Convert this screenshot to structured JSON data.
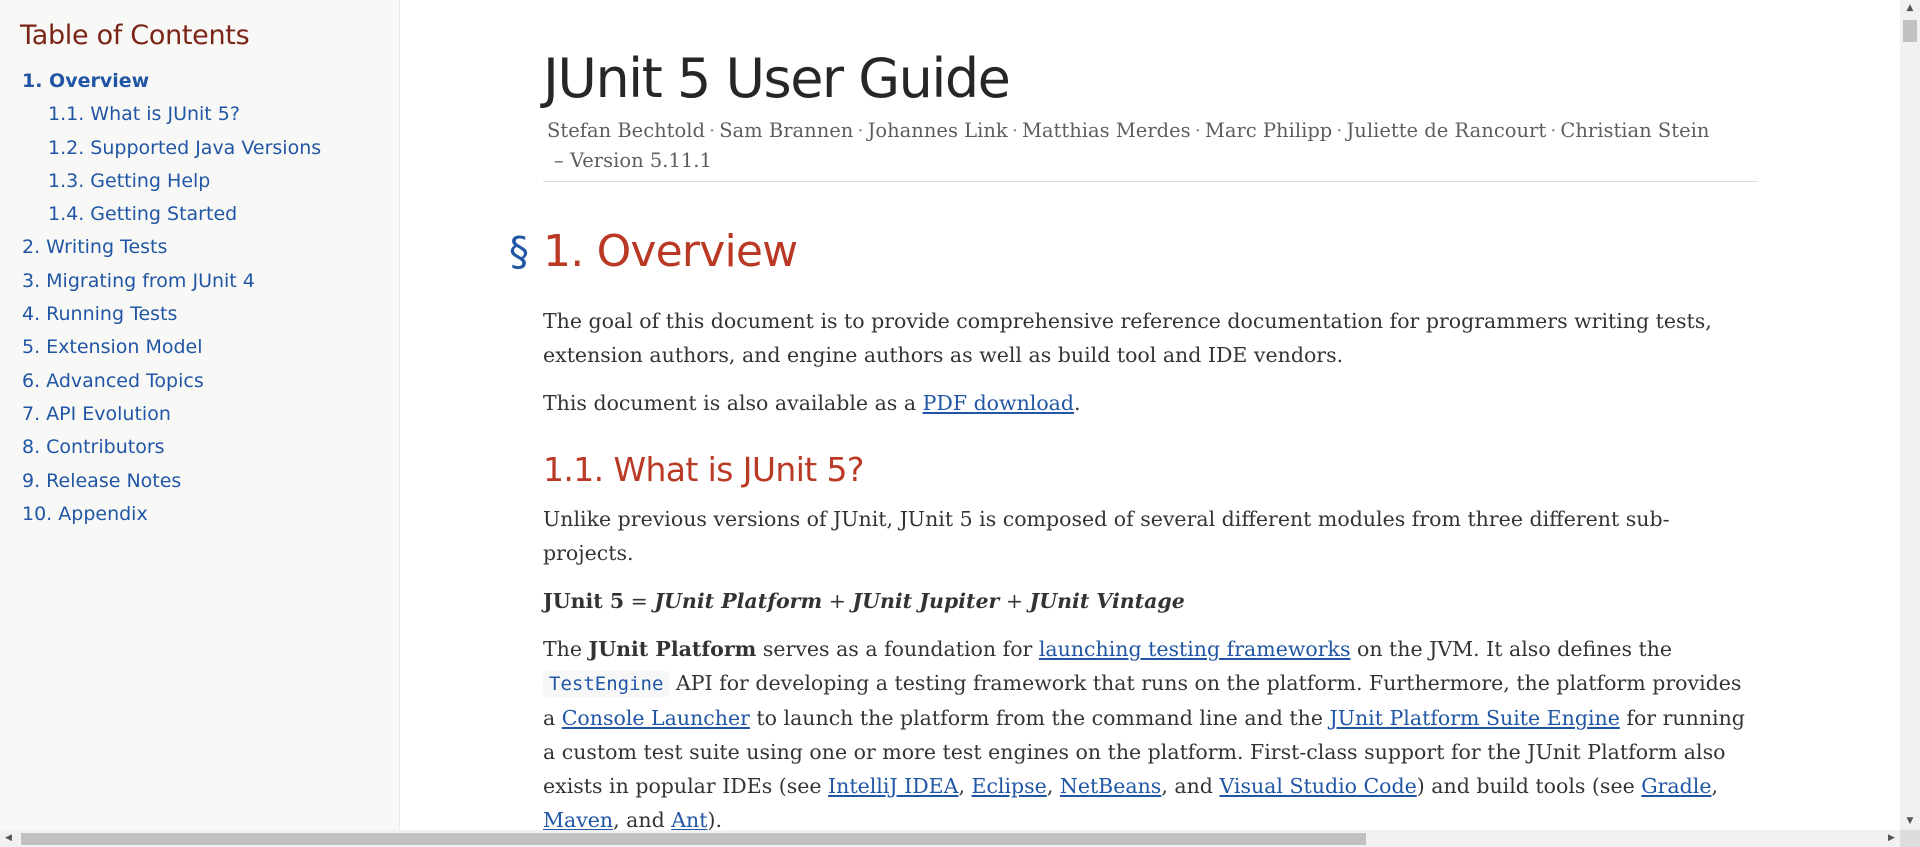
{
  "toc": {
    "title": "Table of Contents",
    "items": [
      {
        "label": "1. Overview",
        "level": 1,
        "active": true
      },
      {
        "label": "1.1. What is JUnit 5?",
        "level": 2
      },
      {
        "label": "1.2. Supported Java Versions",
        "level": 2
      },
      {
        "label": "1.3. Getting Help",
        "level": 2
      },
      {
        "label": "1.4. Getting Started",
        "level": 2
      },
      {
        "label": "2. Writing Tests",
        "level": 1
      },
      {
        "label": "3. Migrating from JUnit 4",
        "level": 1
      },
      {
        "label": "4. Running Tests",
        "level": 1
      },
      {
        "label": "5. Extension Model",
        "level": 1
      },
      {
        "label": "6. Advanced Topics",
        "level": 1
      },
      {
        "label": "7. API Evolution",
        "level": 1
      },
      {
        "label": "8. Contributors",
        "level": 1
      },
      {
        "label": "9. Release Notes",
        "level": 1
      },
      {
        "label": "10. Appendix",
        "level": 1
      }
    ]
  },
  "header": {
    "title": "JUnit 5 User Guide",
    "authors": [
      "Stefan Bechtold",
      "Sam Brannen",
      "Johannes Link",
      "Matthias Merdes",
      "Marc Philipp",
      "Juliette de Rancourt",
      "Christian Stein"
    ],
    "separator": "·",
    "version": "– Version 5.11.1"
  },
  "overview": {
    "anchor": "§",
    "heading": "1. Overview",
    "p1": "The goal of this document is to provide comprehensive reference documentation for programmers writing tests, extension authors, and engine authors as well as build tool and IDE vendors.",
    "p2_prefix": "This document is also available as a ",
    "p2_link": "PDF download",
    "p2_suffix": "."
  },
  "what_is": {
    "heading": "1.1. What is JUnit 5?",
    "p1": "Unlike previous versions of JUnit, JUnit 5 is composed of several different modules from three different sub-projects.",
    "formula": {
      "lhs": "JUnit 5",
      "eq": " = ",
      "platform": "JUnit Platform",
      "plus": " + ",
      "jupiter": "JUnit Jupiter",
      "vintage": "JUnit Vintage"
    },
    "p3": {
      "t1": "The ",
      "b1": "JUnit Platform",
      "t2": " serves as a foundation for ",
      "l1": "launching testing frameworks",
      "t3": " on the JVM. It also defines the ",
      "code1": "TestEngine",
      "t4": " API for developing a testing framework that runs on the platform. Furthermore, the platform provides a ",
      "l2": "Console Launcher",
      "t5": " to launch the platform from the command line and the ",
      "l3": "JUnit Platform Suite Engine",
      "t6": " for running a custom test suite using one or more test engines on the platform. First-class support for the JUnit Platform also exists in popular IDEs (see ",
      "l4": "IntelliJ IDEA",
      "sep1": ", ",
      "l5": "Eclipse",
      "sep2": ", ",
      "l6": "NetBeans",
      "t7": ", and ",
      "l7": "Visual Studio Code",
      "t8": ") and build tools (see ",
      "l8": "Gradle",
      "sep3": ", ",
      "l9": "Maven",
      "t9": ", and ",
      "l10": "Ant",
      "t10": ")."
    }
  },
  "scrollbars": {
    "up_icon": "▲",
    "down_icon": "▼",
    "left_icon": "◀",
    "right_icon": "▶"
  }
}
